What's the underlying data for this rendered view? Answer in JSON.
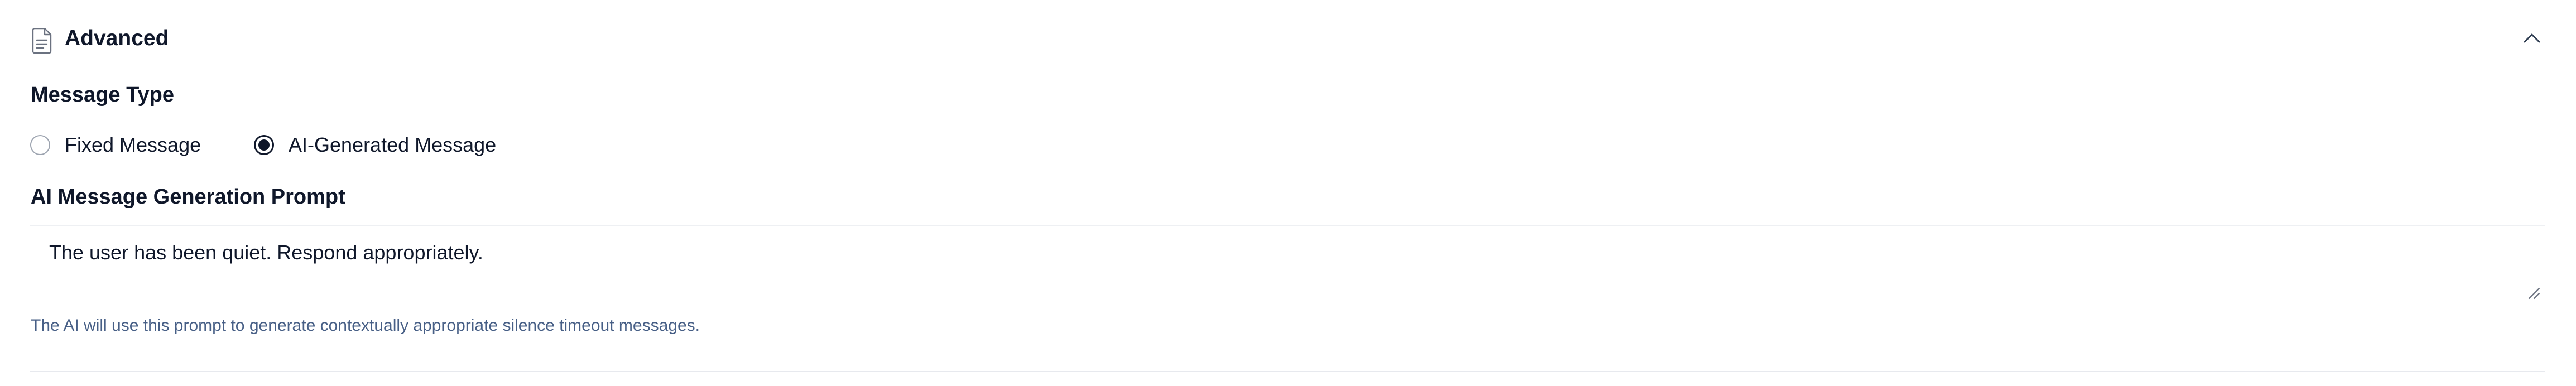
{
  "section": {
    "title": "Advanced",
    "icon": "document-icon",
    "collapse_icon": "chevron-up-icon"
  },
  "message_type": {
    "label": "Message Type",
    "options": [
      {
        "label": "Fixed Message",
        "selected": false
      },
      {
        "label": "AI-Generated Message",
        "selected": true
      }
    ]
  },
  "prompt": {
    "label": "AI Message Generation Prompt",
    "value": "The user has been quiet. Respond appropriately.",
    "helper_text": "The AI will use this prompt to generate contextually appropriate silence timeout messages."
  },
  "colors": {
    "text": "#0f172a",
    "helper_text": "#475f86",
    "border": "#e7e9ee"
  }
}
